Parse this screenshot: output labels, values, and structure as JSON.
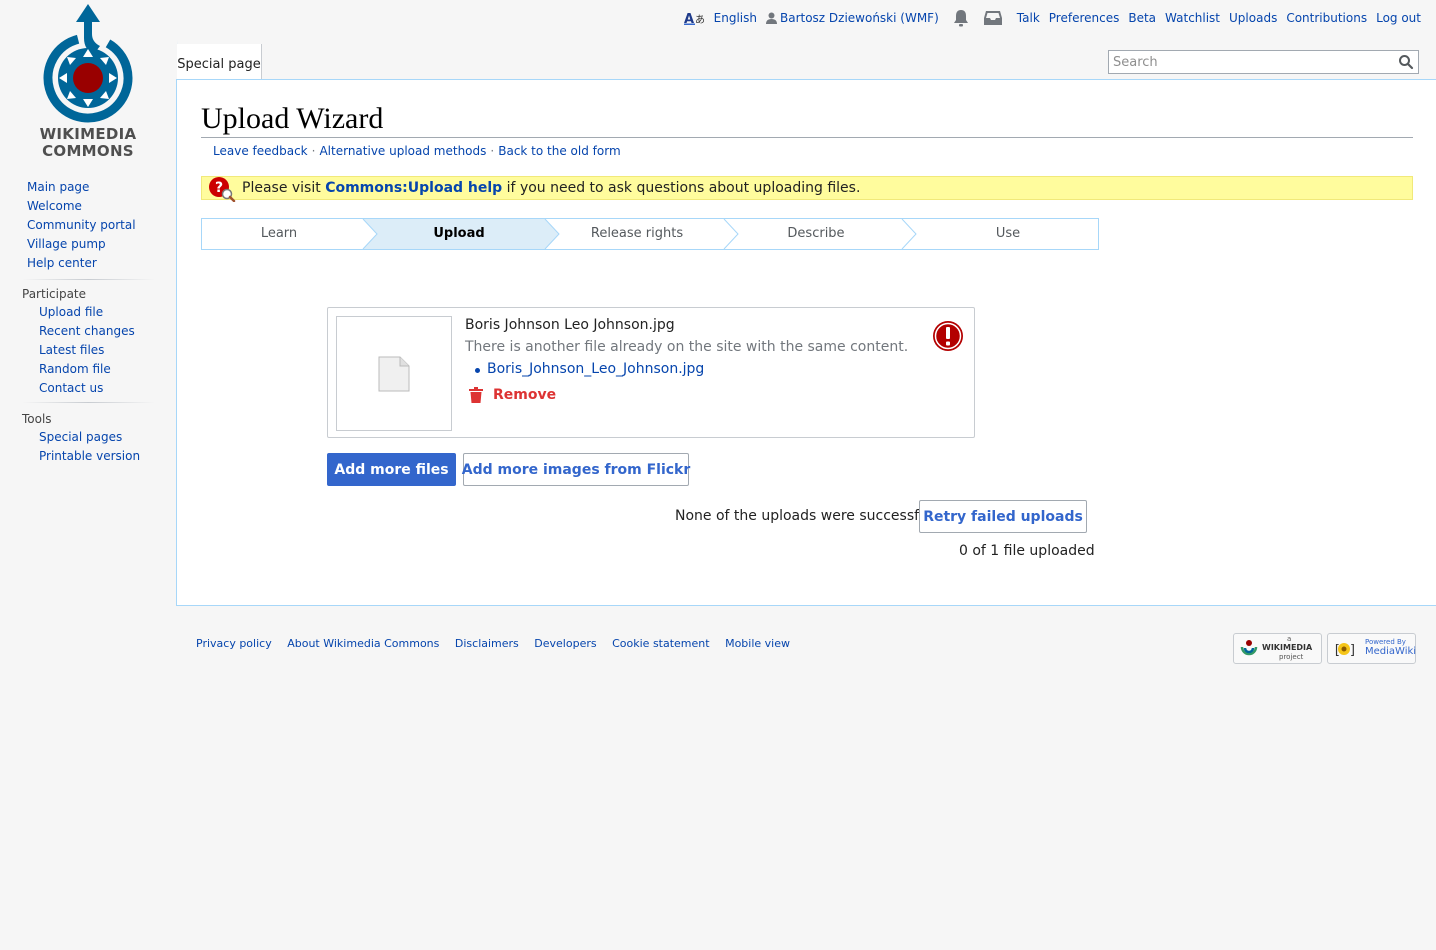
{
  "site": {
    "logo_line1": "WIKIMEDIA",
    "logo_line2": "COMMONS"
  },
  "personal": {
    "language": "English",
    "username": "Bartosz Dziewoński (WMF)",
    "links": [
      "Talk",
      "Preferences",
      "Beta",
      "Watchlist",
      "Uploads",
      "Contributions",
      "Log out"
    ]
  },
  "nav": {
    "main": [
      "Main page",
      "Welcome",
      "Community portal",
      "Village pump",
      "Help center"
    ],
    "participate_heading": "Participate",
    "participate": [
      "Upload file",
      "Recent changes",
      "Latest files",
      "Random file",
      "Contact us"
    ],
    "tools_heading": "Tools",
    "tools": [
      "Special pages",
      "Printable version"
    ]
  },
  "tabs": {
    "special": "Special page"
  },
  "search": {
    "placeholder": "Search"
  },
  "page": {
    "title": "Upload Wizard",
    "toplinks": [
      "Leave feedback",
      "Alternative upload methods",
      "Back to the old form"
    ],
    "notice_pre": "Please visit ",
    "notice_link": "Commons:Upload help",
    "notice_post": " if you need to ask questions about uploading files."
  },
  "steps": {
    "items": [
      "Learn",
      "Upload",
      "Release rights",
      "Describe",
      "Use"
    ],
    "active": "Upload"
  },
  "upload": {
    "filename": "Boris Johnson Leo Johnson.jpg",
    "error": "There is another file already on the site with the same content.",
    "duplicate_link": "Boris_Johnson_Leo_Johnson.jpg",
    "remove": "Remove"
  },
  "buttons": {
    "add_more": "Add more files",
    "flickr": "Add more images from Flickr",
    "retry": "Retry failed uploads"
  },
  "status": {
    "none_success": "None of the uploads were successful.",
    "count": "0 of 1 file uploaded"
  },
  "footer": {
    "links": [
      "Privacy policy",
      "About Wikimedia Commons",
      "Disclaimers",
      "Developers",
      "Cookie statement",
      "Mobile view"
    ],
    "wm_small": "a",
    "wm_name": "WIKIMEDIA",
    "wm_sub": "project",
    "mw_small": "Powered By",
    "mw_name": "MediaWiki"
  },
  "colors": {
    "accent": "#3366cc",
    "link": "#0645ad",
    "error": "#dd3333",
    "notice_bg": "#fffc9d",
    "step_active_bg": "#dcedf8"
  }
}
